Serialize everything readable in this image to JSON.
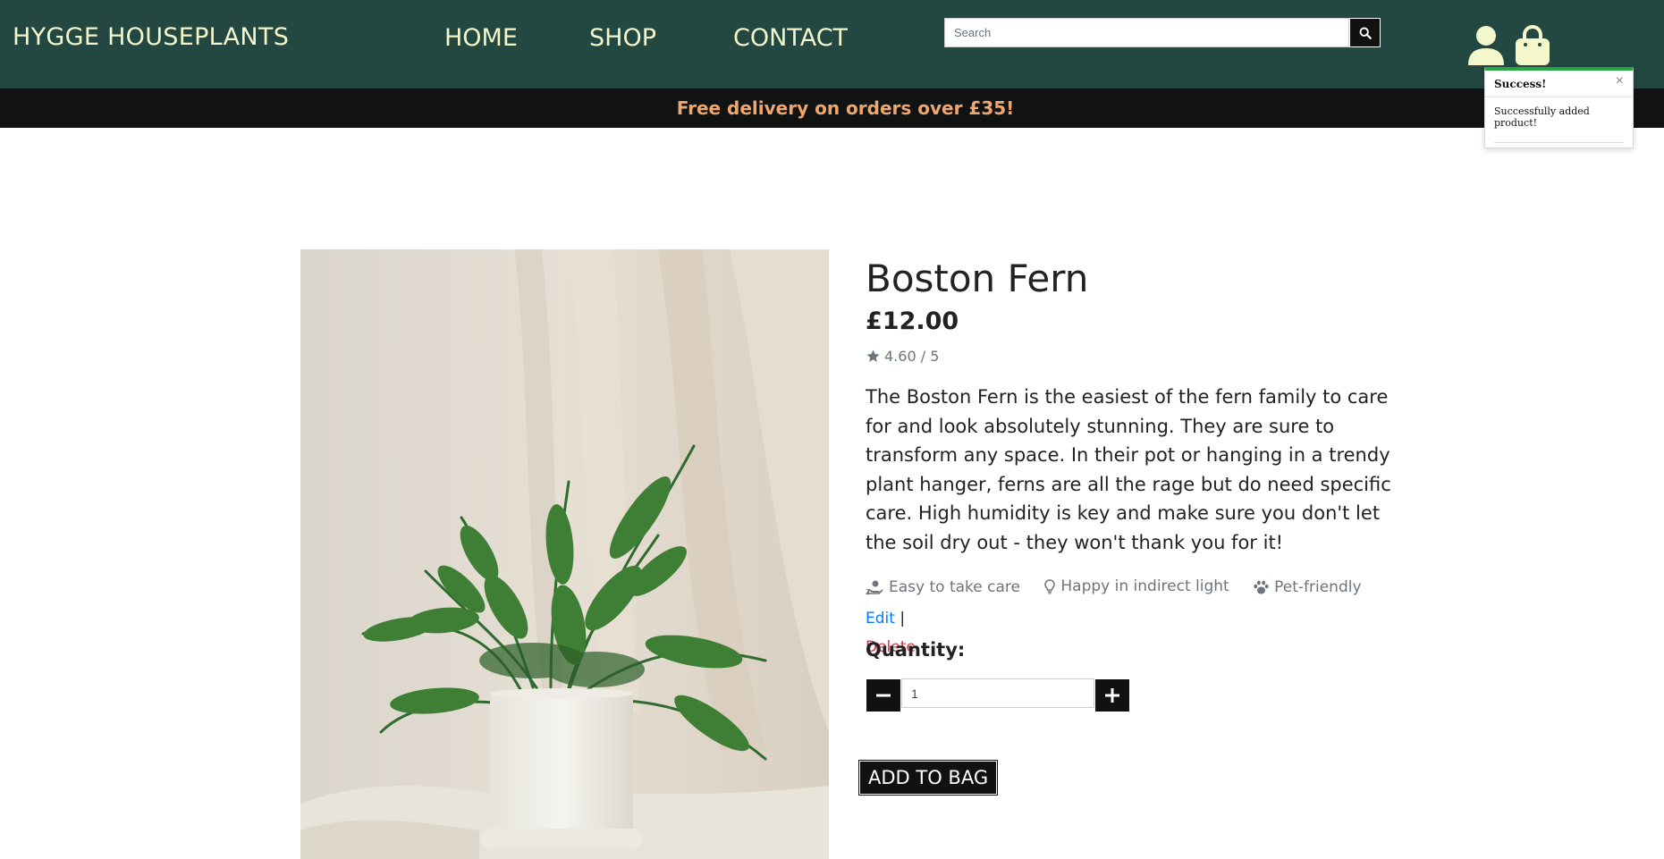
{
  "header": {
    "brand": "HYGGE HOUSEPLANTS",
    "nav": {
      "home": "HOME",
      "shop": "SHOP",
      "contact": "CONTACT"
    },
    "search": {
      "placeholder": "Search",
      "value": ""
    },
    "icons": {
      "search": "search-icon",
      "account": "user-icon",
      "bag": "shopping-bag-icon"
    }
  },
  "banner": {
    "text": "Free delivery on orders over £35!"
  },
  "toast": {
    "title": "Success!",
    "close": "×",
    "message": "Successfully added product!"
  },
  "product": {
    "name": "Boston Fern",
    "price": "£12.00",
    "rating": "4.60 / 5",
    "description": "The Boston Fern is the easiest of the fern family to care for and look absolutely stunning. They are sure to transform any space. In their pot or hanging in a trendy plant hanger, ferns are all the rage but do need specific care. High humidity is key and make sure you don't let the soil dry out - they won't thank you for it!",
    "features": {
      "care": "Easy to take care",
      "light": "Happy in indirect light",
      "pet": "Pet-friendly"
    },
    "admin": {
      "edit": "Edit",
      "separator": "|",
      "delete": "Delete"
    },
    "quantity": {
      "label": "Quantity:",
      "value": "1"
    },
    "add_to_bag": "ADD TO BAG"
  },
  "colors": {
    "navbar": "#234741",
    "brand_text": "#f4f6cc",
    "banner_bg": "#111312",
    "banner_text": "#f0a56d",
    "toast_accent": "#28a745",
    "edit_link": "#007bff",
    "delete_link": "#dc3545"
  }
}
